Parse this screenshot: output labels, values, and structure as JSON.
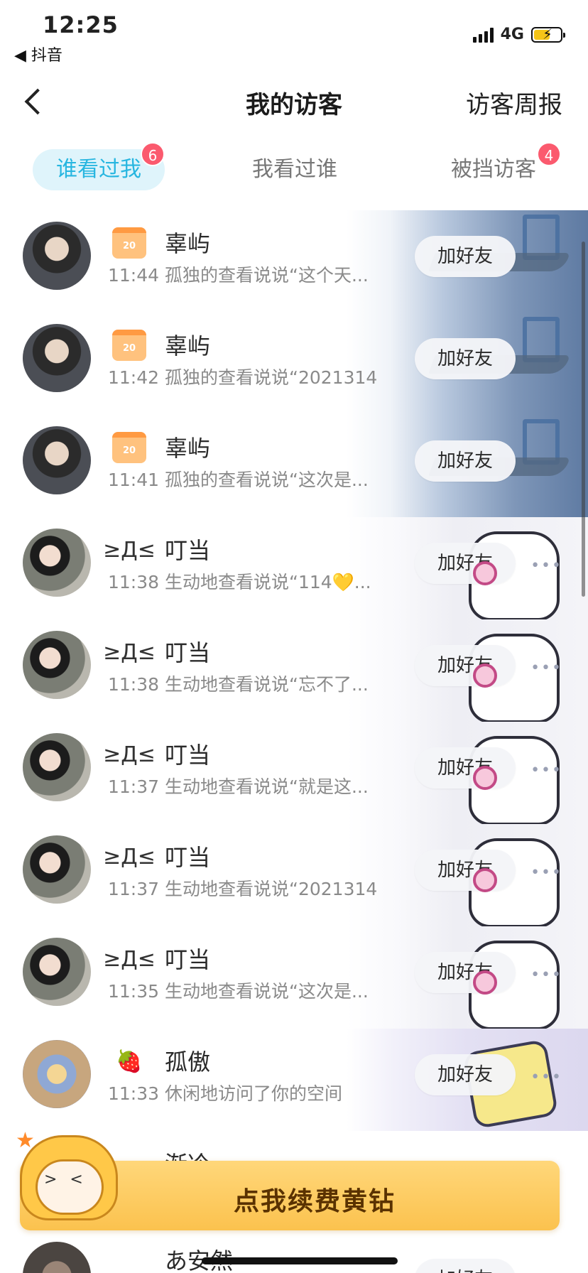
{
  "status_bar": {
    "time": "12:25",
    "back_app": "◀ 抖音",
    "network": "4G"
  },
  "header": {
    "title": "我的访客",
    "right_action": "访客周报"
  },
  "tabs": [
    {
      "label": "谁看过我",
      "badge": "6",
      "active": true
    },
    {
      "label": "我看过谁",
      "badge": "",
      "active": false
    },
    {
      "label": "被挡访客",
      "badge": "4",
      "active": false
    }
  ],
  "visitors": [
    {
      "nickname": "辜屿",
      "icon": "calendar-20-icon",
      "icon_text": "20",
      "desc": "11:44 孤独的查看说说“这个天...",
      "button": "加好友"
    },
    {
      "nickname": "辜屿",
      "icon": "calendar-20-icon",
      "icon_text": "20",
      "desc": "11:42 孤独的查看说说“2021314",
      "button": "加好友"
    },
    {
      "nickname": "辜屿",
      "icon": "calendar-20-icon",
      "icon_text": "20",
      "desc": "11:41 孤独的查看说说“这次是...",
      "button": "加好友"
    },
    {
      "nickname": "叮当",
      "icon": "squint-face-icon",
      "icon_text": "≥Д≤",
      "desc": "11:38 生动地查看说说“114💛...",
      "button": "加好友"
    },
    {
      "nickname": "叮当",
      "icon": "squint-face-icon",
      "icon_text": "≥Д≤",
      "desc": "11:38 生动地查看说说“忘不了...",
      "button": "加好友"
    },
    {
      "nickname": "叮当",
      "icon": "squint-face-icon",
      "icon_text": "≥Д≤",
      "desc": "11:37 生动地查看说说“就是这...",
      "button": "加好友"
    },
    {
      "nickname": "叮当",
      "icon": "squint-face-icon",
      "icon_text": "≥Д≤",
      "desc": "11:37 生动地查看说说“2021314",
      "button": "加好友"
    },
    {
      "nickname": "叮当",
      "icon": "squint-face-icon",
      "icon_text": "≥Д≤",
      "desc": "11:35 生动地查看说说“这次是...",
      "button": "加好友"
    },
    {
      "nickname": "孤傲",
      "icon": "strawberry-icon",
      "icon_text": "🍓",
      "desc": "11:33 休闲地访问了你的空间",
      "button": "加好友"
    }
  ],
  "partial_rows": [
    {
      "nickname": "渐冷"
    },
    {
      "nickname": "あ安然",
      "button": "加好友"
    }
  ],
  "banner": {
    "label": "点我续费黄钻"
  },
  "more_dots": "•••"
}
